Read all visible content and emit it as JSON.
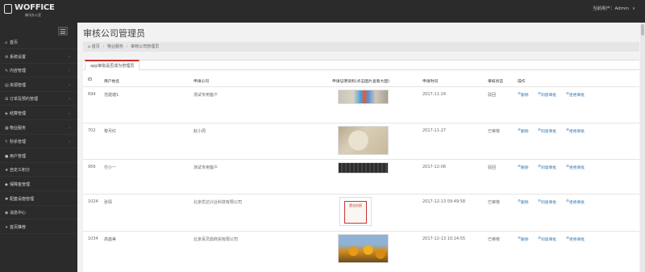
{
  "app": {
    "logo_main": "WOFFICE",
    "logo_sub": "蜂沃办公室"
  },
  "header": {
    "user_label": "当前用户：Admin"
  },
  "sidebar": {
    "items": [
      {
        "label": "首页",
        "icon": "home-icon",
        "has_children": false
      },
      {
        "label": "系统设置",
        "icon": "gear-icon",
        "has_children": true
      },
      {
        "label": "内容管理",
        "icon": "edit-icon",
        "has_children": true
      },
      {
        "label": "资源管理",
        "icon": "folder-icon",
        "has_children": true
      },
      {
        "label": "订单及预约管理",
        "icon": "cart-icon",
        "has_children": true
      },
      {
        "label": "结算管理",
        "icon": "money-icon",
        "has_children": true
      },
      {
        "label": "物业服务",
        "icon": "building-icon",
        "has_children": true
      },
      {
        "label": "秒杀管理",
        "icon": "bolt-icon",
        "has_children": true
      },
      {
        "label": "用户管理",
        "icon": "user-icon",
        "has_children": false
      },
      {
        "label": "自定义积分",
        "icon": "star-icon",
        "has_children": false
      },
      {
        "label": "保障金管理",
        "icon": "shield-icon",
        "has_children": false
      },
      {
        "label": "配套设施管理",
        "icon": "wrench-icon",
        "has_children": false
      },
      {
        "label": "消息中心",
        "icon": "bell-icon",
        "has_children": false
      },
      {
        "label": "首页推荐",
        "icon": "thumb-icon",
        "has_children": false
      }
    ]
  },
  "main": {
    "title": "审核公司管理员",
    "breadcrumb": [
      "首页",
      "物业服务",
      "审核公司管理员"
    ],
    "tab_label": "app审批是否成为管理员",
    "columns": [
      "ID",
      "用户姓名",
      "申请公司",
      "申请证明资料(点击图片查看大图)",
      "申请时间",
      "审核状态",
      "操作"
    ],
    "rows": [
      {
        "id": "694",
        "name": "范建塘1",
        "company": "测试专用客户",
        "time": "2017-11-24",
        "status": "驳回",
        "photo": "desk",
        "actions": [
          "删除",
          "同意审批",
          "拒绝审批"
        ]
      },
      {
        "id": "702",
        "name": "黎月红",
        "company": "赵小周",
        "time": "2017-11-27",
        "status": "已审核",
        "photo": "certificate",
        "actions": [
          "删除",
          "同意审批",
          "拒绝审批"
        ]
      },
      {
        "id": "956",
        "name": "付小一",
        "company": "测试专用客户",
        "time": "2017-12-06",
        "status": "驳回",
        "photo": "keyboard",
        "actions": [
          "删除",
          "同意审批",
          "拒绝审批"
        ]
      },
      {
        "id": "1024",
        "name": "张倩",
        "company": "北京优达兴业科技有限公司",
        "time": "2017-12-13 09:49:58",
        "status": "已审核",
        "photo": "license",
        "actions": [
          "删除",
          "同意审批",
          "拒绝审批"
        ]
      },
      {
        "id": "1034",
        "name": "高盛美",
        "company": "北京百灵鼎商贸有限公司",
        "time": "2017-12-13 10:14:55",
        "status": "已审核",
        "photo": "sunflowers",
        "actions": [
          "删除",
          "同意审批",
          "拒绝审批"
        ]
      }
    ]
  },
  "colors": {
    "topbar": "#2b2b2b",
    "sidebar": "#2b2b2b",
    "accent_red": "#c9302c",
    "link_blue": "#337ab7"
  }
}
